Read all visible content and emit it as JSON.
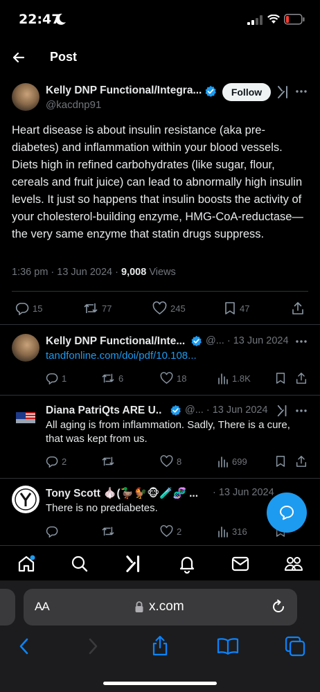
{
  "status": {
    "time": "22:47"
  },
  "header": {
    "title": "Post"
  },
  "main_post": {
    "author_name": "Kelly DNP Functional/Integra...",
    "handle": "@kacdnp91",
    "follow_label": "Follow",
    "text": "Heart disease is about insulin resistance (aka pre-diabetes) and inflammation within your blood vessels. Diets high in refined carbohydrates (like sugar, flour, cereals and fruit juice) can lead to abnormally high insulin levels. It just so happens that insulin boosts the activity of your cholesterol-building enzyme, HMG-CoA-reductase—the very same enzyme that statin drugs suppress.",
    "timestamp": "1:36 pm · 13 Jun 2024 · ",
    "views_count": "9,008",
    "views_label": " Views",
    "actions": {
      "replies": "15",
      "reposts": "77",
      "likes": "245",
      "bookmarks": "47"
    }
  },
  "replies": [
    {
      "author_name": "Kelly DNP Functional/Inte...",
      "handle_date": "@... · 13 Jun 2024",
      "link": "tandfonline.com/doi/pdf/10.108...",
      "replies": "1",
      "reposts": "6",
      "likes": "18",
      "views": "1.8K"
    },
    {
      "author_name": "Diana PatriQts ARE U...",
      "handle_date": "@... · 13 Jun 2024",
      "text": "All aging is from inflammation. Sadly, There is a cure, that was kept from us.",
      "replies": "2",
      "reposts": "",
      "likes": "8",
      "views": "699"
    },
    {
      "author_name": "Tony Scott 🧄(🦆🐓🐵🧪🧬 ...",
      "handle_date": "· 13 Jun 2024",
      "text": "There is no prediabetes.",
      "replies": "",
      "reposts": "",
      "likes": "2",
      "views": "316"
    }
  ],
  "browser": {
    "aa_label": "AA",
    "url": "x.com"
  },
  "colors": {
    "accent": "#1d9bf0",
    "background": "#000000",
    "muted": "#71767b"
  }
}
